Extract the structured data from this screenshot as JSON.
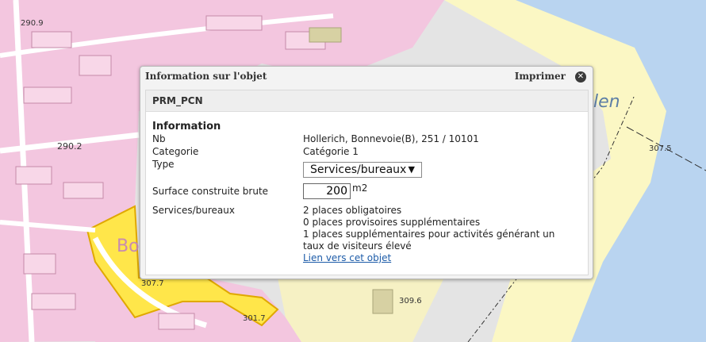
{
  "map": {
    "labels": [
      "290.9",
      "290.2",
      "307.5",
      "309.6",
      "301.7",
      "307.7",
      "Bo",
      "len"
    ]
  },
  "popup": {
    "title": "Information sur l'objet",
    "print_label": "Imprimer",
    "close_icon": "close-icon",
    "layer_name": "PRM_PCN",
    "section_title": "Information",
    "fields": {
      "nb_label": "Nb",
      "nb_value": "Hollerich, Bonnevoie(B), 251 / 10101",
      "categorie_label": "Categorie",
      "categorie_value": "Catégorie 1",
      "type_label": "Type",
      "type_selected": "Services/bureaux",
      "surface_label": "Surface construite brute",
      "surface_value": "200",
      "surface_unit": "m2",
      "services_label": "Services/bureaux",
      "services_lines": [
        "2 places obligatoires",
        "0 places provisoires supplémentaires",
        "1 places supplémentaires pour activités générant un",
        "taux de visiteurs élevé"
      ],
      "object_link": "Lien vers cet objet"
    }
  }
}
